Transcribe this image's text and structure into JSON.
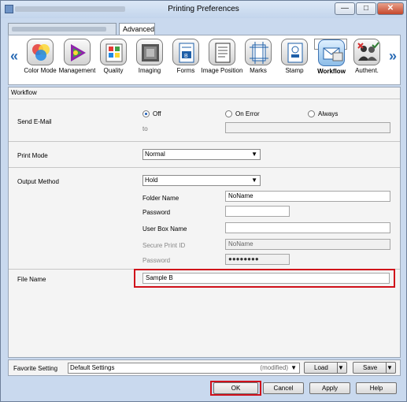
{
  "window": {
    "title": "Printing Preferences",
    "minimize_glyph": "—",
    "maximize_glyph": "□",
    "close_glyph": "✕"
  },
  "tabs": [
    {
      "label": ""
    },
    {
      "label": "Advanced"
    }
  ],
  "toolbar": {
    "prev_glyph": "«",
    "next_glyph": "»",
    "items": [
      {
        "label": "Color Mode",
        "icon": "color-mode-icon"
      },
      {
        "label": "Management",
        "icon": "management-icon"
      },
      {
        "label": "Quality",
        "icon": "quality-icon"
      },
      {
        "label": "Imaging",
        "icon": "imaging-icon"
      },
      {
        "label": "Forms",
        "icon": "forms-icon"
      },
      {
        "label": "Image Position",
        "icon": "image-position-icon"
      },
      {
        "label": "Marks",
        "icon": "marks-icon"
      },
      {
        "label": "Stamp",
        "icon": "stamp-icon"
      },
      {
        "label": "Workflow",
        "icon": "workflow-icon",
        "selected": true
      },
      {
        "label": "Authent.",
        "icon": "authentication-icon"
      }
    ]
  },
  "panel": {
    "heading": "Workflow",
    "send_email": {
      "label": "Send E-Mail",
      "options": [
        "Off",
        "On Error",
        "Always"
      ],
      "selected": "Off",
      "to_label": "to",
      "to_value": ""
    },
    "print_mode": {
      "label": "Print Mode",
      "value": "Normal"
    },
    "output_method": {
      "label": "Output Method",
      "value": "Hold",
      "folder_name_label": "Folder Name",
      "folder_name_value": "NoName",
      "password_label": "Password",
      "password_value": "",
      "user_box_label": "User Box Name",
      "user_box_value": "",
      "secure_id_label": "Secure Print ID",
      "secure_id_value": "NoName",
      "secure_pw_label": "Password",
      "secure_pw_value": "●●●●●●●●"
    },
    "file_name": {
      "label": "File Name",
      "value": "Sample B"
    }
  },
  "favorite": {
    "label": "Favorite Setting",
    "value": "Default Settings",
    "modified": "(modified)",
    "load_label": "Load",
    "save_label": "Save"
  },
  "buttons": {
    "ok": "OK",
    "cancel": "Cancel",
    "apply": "Apply",
    "help": "Help"
  },
  "colors": {
    "highlight": "#d0101a",
    "selected_tool": "#3f74b3"
  }
}
